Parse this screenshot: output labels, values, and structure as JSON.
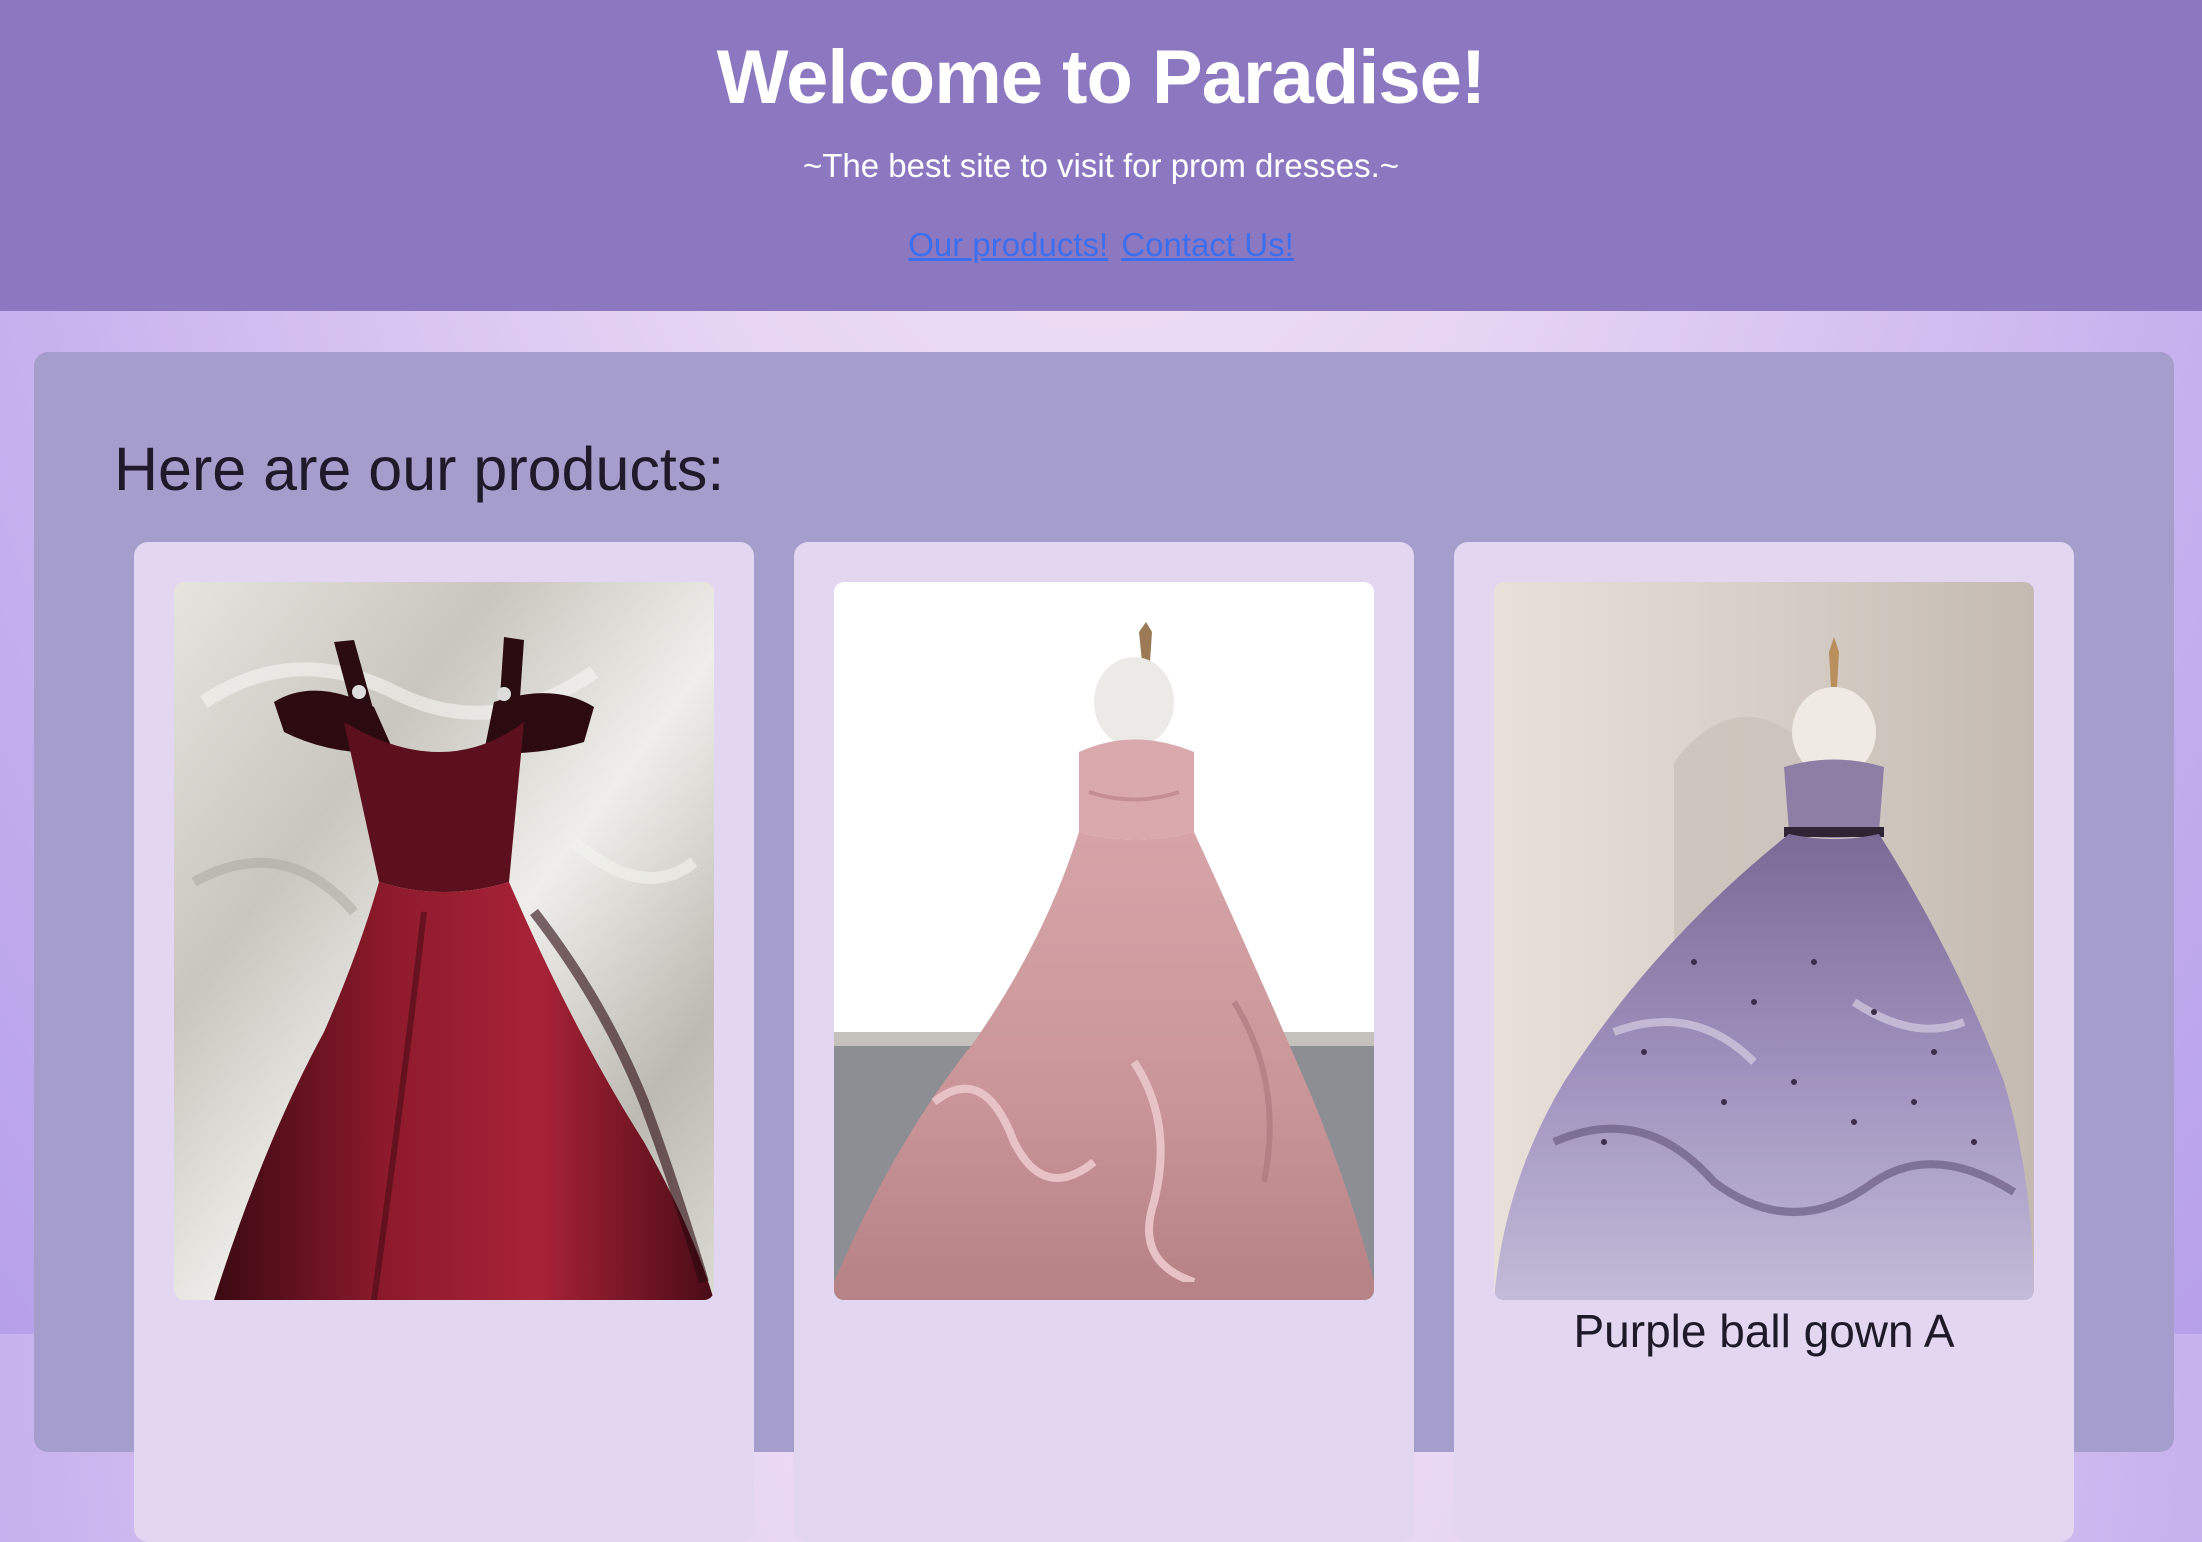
{
  "header": {
    "title": "Welcome to Paradise!",
    "tagline": "~The best site to visit for prom dresses.~",
    "nav": [
      {
        "label": "Our products!"
      },
      {
        "label": "Contact Us!"
      }
    ]
  },
  "products_section": {
    "heading": "Here are our products:",
    "products": [
      {
        "name": "",
        "image": "burgundy-tulle-gown-photo"
      },
      {
        "name": "",
        "image": "pink-ball-gown-photo"
      },
      {
        "name": "Purple ball gown A",
        "image": "purple-ball-gown-photo"
      }
    ]
  },
  "colors": {
    "header_bg": "#8c78c1",
    "panel_bg": "#a59dcb",
    "card_bg": "#e2d6f1",
    "link": "#3b6ff0"
  }
}
